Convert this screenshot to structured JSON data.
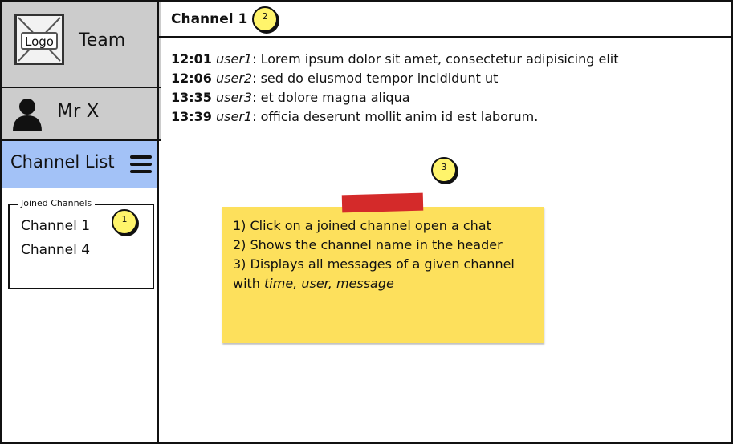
{
  "team": {
    "logo_label": "Logo",
    "name": "Team"
  },
  "user": {
    "name": "Mr X"
  },
  "sidebar": {
    "channel_list_title": "Channel List",
    "joined_group_label": "Joined Channels",
    "joined_channels": [
      "Channel 1",
      "Channel 4"
    ]
  },
  "chat": {
    "title": "Channel 1",
    "messages": [
      {
        "time": "12:01",
        "user": "user1",
        "text": "Lorem ipsum dolor sit amet, consectetur adipisicing elit"
      },
      {
        "time": "12:06",
        "user": "user2",
        "text": "sed do eiusmod tempor incididunt ut"
      },
      {
        "time": "13:35",
        "user": "user3",
        "text": " et dolore magna aliqua"
      },
      {
        "time": "13:39",
        "user": "user1",
        "text": " officia deserunt mollit anim id est laborum."
      }
    ]
  },
  "callouts": {
    "c1": "1",
    "c2": "2",
    "c3": "3"
  },
  "note": {
    "line1": "1) Click on a joined channel open a chat",
    "line2": "2) Shows the channel name in the header",
    "line3_prefix": "3) Displays all messages of a given channel with ",
    "line3_italic": "time, user, message"
  },
  "colors": {
    "panel_gray": "#cccccc",
    "channel_header_blue": "#a3c2f7",
    "sticky_yellow": "#fde05c",
    "tape_red": "#d42a2a",
    "callout_yellow": "#fff46b"
  }
}
